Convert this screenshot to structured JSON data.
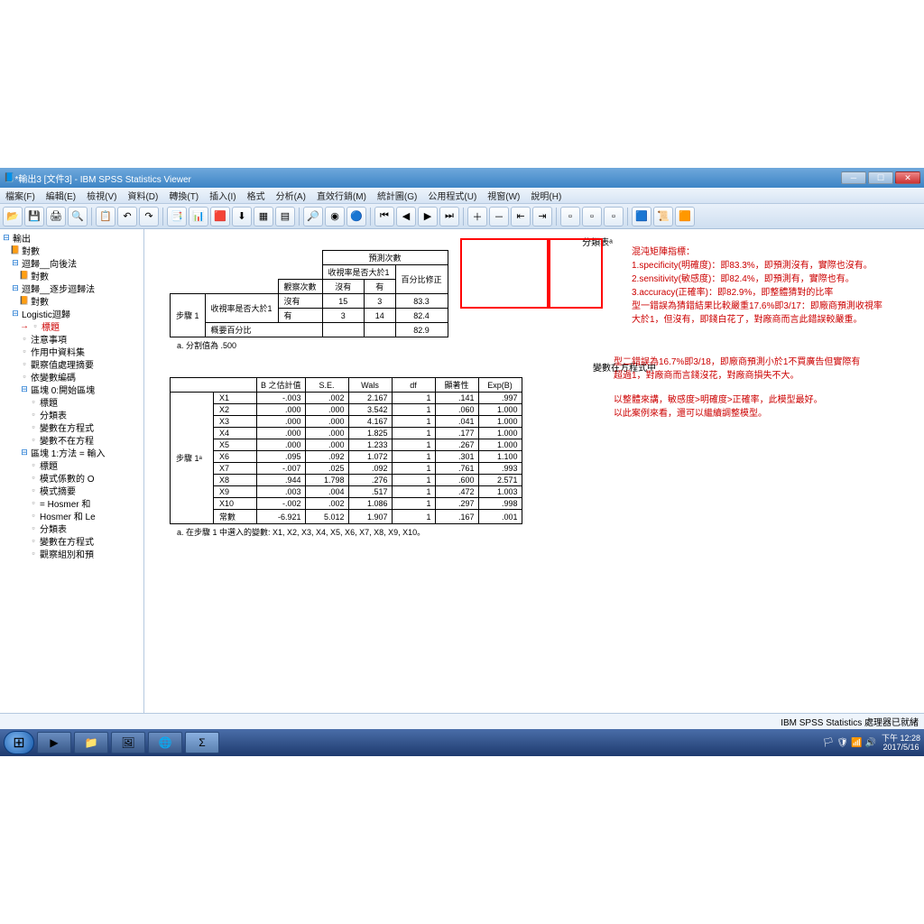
{
  "window": {
    "title": "*輸出3 [文件3] - IBM SPSS Statistics Viewer"
  },
  "menu": [
    "檔案(F)",
    "編輯(E)",
    "檢視(V)",
    "資料(D)",
    "轉換(T)",
    "插入(I)",
    "格式",
    "分析(A)",
    "直效行銷(M)",
    "統計圖(G)",
    "公用程式(U)",
    "視窗(W)",
    "說明(H)"
  ],
  "outline": [
    {
      "d": 0,
      "t": "f",
      "l": "輸出"
    },
    {
      "d": 1,
      "t": "d",
      "l": "對數"
    },
    {
      "d": 1,
      "t": "f",
      "l": "迴歸__向後法"
    },
    {
      "d": 2,
      "t": "d",
      "l": "對數"
    },
    {
      "d": 1,
      "t": "f",
      "l": "迴歸__逐步迴歸法"
    },
    {
      "d": 2,
      "t": "d",
      "l": "對數"
    },
    {
      "d": 1,
      "t": "f",
      "l": "Logistic迴歸"
    },
    {
      "d": 2,
      "t": "l",
      "l": "標題",
      "sel": true
    },
    {
      "d": 2,
      "t": "l",
      "l": "注意事項"
    },
    {
      "d": 2,
      "t": "l",
      "l": "作用中資料集"
    },
    {
      "d": 2,
      "t": "l",
      "l": "觀察值處理摘要"
    },
    {
      "d": 2,
      "t": "l",
      "l": "依變數編碼"
    },
    {
      "d": 2,
      "t": "f",
      "l": "區塊 0:開始區塊"
    },
    {
      "d": 3,
      "t": "l",
      "l": "標題"
    },
    {
      "d": 3,
      "t": "l",
      "l": "分類表"
    },
    {
      "d": 3,
      "t": "l",
      "l": "變數在方程式"
    },
    {
      "d": 3,
      "t": "l",
      "l": "變數不在方程"
    },
    {
      "d": 2,
      "t": "f",
      "l": "區塊 1:方法 = 輸入"
    },
    {
      "d": 3,
      "t": "l",
      "l": "標題"
    },
    {
      "d": 3,
      "t": "l",
      "l": "模式係數的 O"
    },
    {
      "d": 3,
      "t": "l",
      "l": "模式摘要"
    },
    {
      "d": 3,
      "t": "l",
      "l": "= Hosmer 和"
    },
    {
      "d": 3,
      "t": "l",
      "l": "Hosmer 和 Le"
    },
    {
      "d": 3,
      "t": "l",
      "l": "分類表"
    },
    {
      "d": 3,
      "t": "l",
      "l": "變數在方程式"
    },
    {
      "d": 3,
      "t": "l",
      "l": "觀察組別和預"
    }
  ],
  "classTable": {
    "title": "分類表ᵃ",
    "h_pred": "預測次數",
    "h_ratio": "收視率是否大於1",
    "h_obs": "觀察次數",
    "h_no": "沒有",
    "h_yes": "有",
    "h_pct": "百分比修正",
    "step": "步驟 1",
    "rowlab": "收視率是否大於1",
    "r1": {
      "lab": "沒有",
      "v1": "15",
      "v2": "3",
      "pct": "83.3"
    },
    "r2": {
      "lab": "有",
      "v1": "3",
      "v2": "14",
      "pct": "82.4"
    },
    "r3": {
      "lab": "概要百分比",
      "pct": "82.9"
    },
    "foot": "a. 分割值為 .500"
  },
  "varTable": {
    "title": "變數在方程式中",
    "headers": [
      "B 之估計值",
      "S.E.",
      "Wals",
      "df",
      "顯著性",
      "Exp(B)"
    ],
    "step": "步驟 1ᵃ",
    "rows": [
      {
        "n": "X1",
        "b": "-.003",
        "se": ".002",
        "w": "2.167",
        "df": "1",
        "sig": ".141",
        "exp": ".997"
      },
      {
        "n": "X2",
        "b": ".000",
        "se": ".000",
        "w": "3.542",
        "df": "1",
        "sig": ".060",
        "exp": "1.000"
      },
      {
        "n": "X3",
        "b": ".000",
        "se": ".000",
        "w": "4.167",
        "df": "1",
        "sig": ".041",
        "exp": "1.000"
      },
      {
        "n": "X4",
        "b": ".000",
        "se": ".000",
        "w": "1.825",
        "df": "1",
        "sig": ".177",
        "exp": "1.000"
      },
      {
        "n": "X5",
        "b": ".000",
        "se": ".000",
        "w": "1.233",
        "df": "1",
        "sig": ".267",
        "exp": "1.000"
      },
      {
        "n": "X6",
        "b": ".095",
        "se": ".092",
        "w": "1.072",
        "df": "1",
        "sig": ".301",
        "exp": "1.100"
      },
      {
        "n": "X7",
        "b": "-.007",
        "se": ".025",
        "w": ".092",
        "df": "1",
        "sig": ".761",
        "exp": ".993"
      },
      {
        "n": "X8",
        "b": ".944",
        "se": "1.798",
        "w": ".276",
        "df": "1",
        "sig": ".600",
        "exp": "2.571"
      },
      {
        "n": "X9",
        "b": ".003",
        "se": ".004",
        "w": ".517",
        "df": "1",
        "sig": ".472",
        "exp": "1.003"
      },
      {
        "n": "X10",
        "b": "-.002",
        "se": ".002",
        "w": "1.086",
        "df": "1",
        "sig": ".297",
        "exp": ".998"
      },
      {
        "n": "常數",
        "b": "-6.921",
        "se": "5.012",
        "w": "1.907",
        "df": "1",
        "sig": ".167",
        "exp": ".001"
      }
    ],
    "foot": "a. 在步驟 1 中選入的變數: X1, X2, X3, X4, X5, X6, X7, X8, X9, X10。"
  },
  "annot": {
    "a1": "混沌矩陣指標：",
    "a2": "1.specificity(明確度)：即83.3%，即預測沒有，實際也沒有。",
    "a3": "2.sensitivity(敏感度)：即82.4%，即預測有，實際也有。",
    "a4": "3.accuracy(正確率)：即82.9%，即整體猜對的比率",
    "a5": "型一錯誤為猜錯結果比較嚴重17.6%即3/17：即廠商預測收視率",
    "a6": "大於1，但沒有，即錢白花了，對廠商而言此錯誤較嚴重。",
    "b1": "型二錯誤為16.7%即3/18，即廠商預測小於1不買廣告但實際有",
    "b2": "超過1，對廠商而言錢沒花，對廠商損失不大。",
    "b3": "以整體來講，敏感度>明確度>正確率，此模型最好。",
    "b4": "以此案例來看，還可以繼續調整模型。"
  },
  "status": "IBM SPSS Statistics 處理器已就緒",
  "tray": {
    "time": "下午 12:28",
    "date": "2017/5/16"
  },
  "icons": {
    "open": "📂",
    "save": "💾",
    "print": "🖨",
    "preview": "🔍",
    "undo": "↶",
    "redo": "↷",
    "chart": "📊",
    "run": "▶",
    "table": "▦",
    "find": "🔎",
    "ball": "🔵",
    "left": "◀",
    "right": "▶",
    "plus": "＋",
    "minus": "－",
    "tree": "🌳"
  }
}
